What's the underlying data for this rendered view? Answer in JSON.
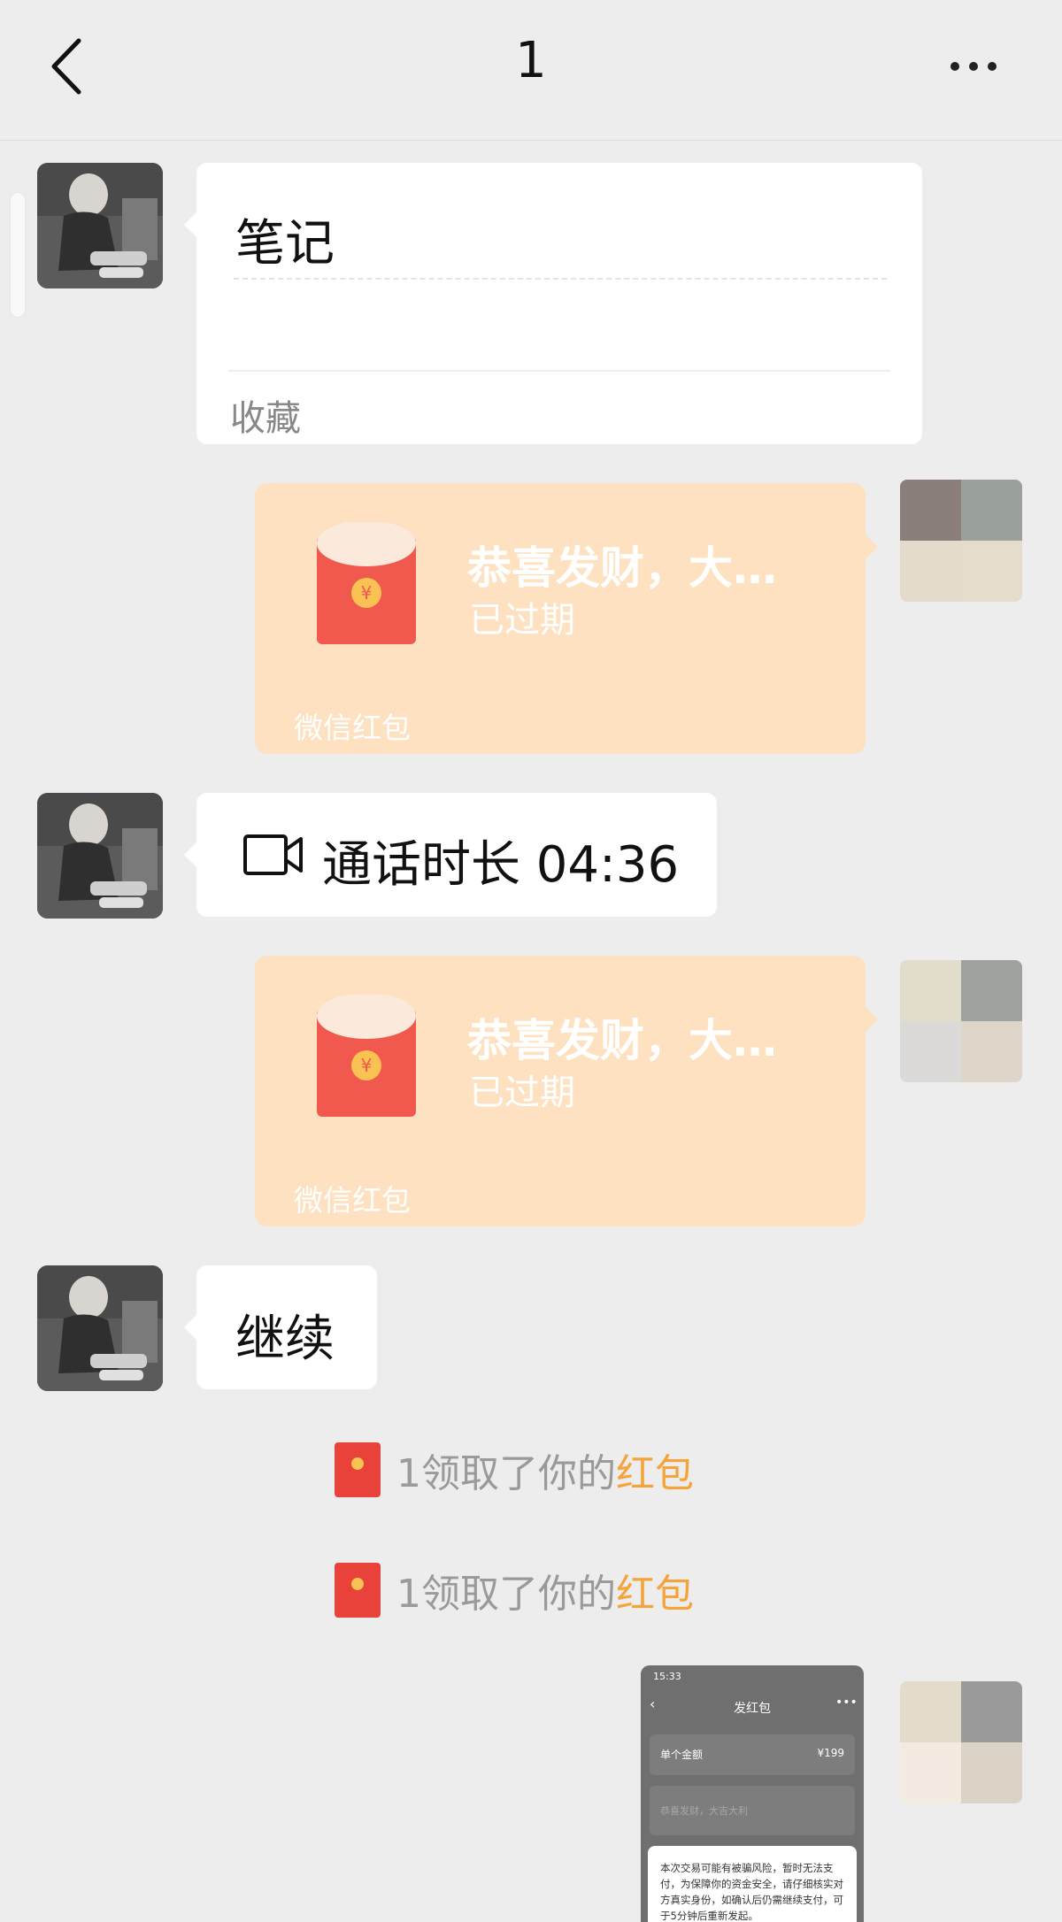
{
  "header": {
    "title": "1",
    "back_icon": "chevron-left-icon",
    "more_icon": "more-dots-icon"
  },
  "messages": {
    "note": {
      "title": "笔记",
      "footer": "收藏"
    },
    "red_packet_1": {
      "title": "恭喜发财，大…",
      "status": "已过期",
      "footer": "微信红包"
    },
    "call": {
      "icon": "video-call-icon",
      "text": "通话时长 04:36"
    },
    "red_packet_2": {
      "title": "恭喜发财，大…",
      "status": "已过期",
      "footer": "微信红包"
    },
    "continue": {
      "text": "继续"
    },
    "system_1": {
      "prefix": "1领取了你的",
      "link": "红包"
    },
    "system_2": {
      "prefix": "1领取了你的",
      "link": "红包"
    },
    "screenshot": {
      "status_time": "15:33",
      "title": "发红包",
      "row1_label": "单个金额",
      "row1_value": "¥199",
      "row2_placeholder": "恭喜发财，大吉大利",
      "dialog_text": "本次交易可能有被骗风险，暂时无法支付，为保障你的资金安全，请仔细核实对方真实身份，如确认后仍需继续支付，可于5分钟后重新发起。"
    }
  },
  "colors": {
    "background": "#ededed",
    "red_packet_expired": "#fde1c1",
    "link_orange": "#f5a33a",
    "envelope_red": "#f1594f"
  }
}
